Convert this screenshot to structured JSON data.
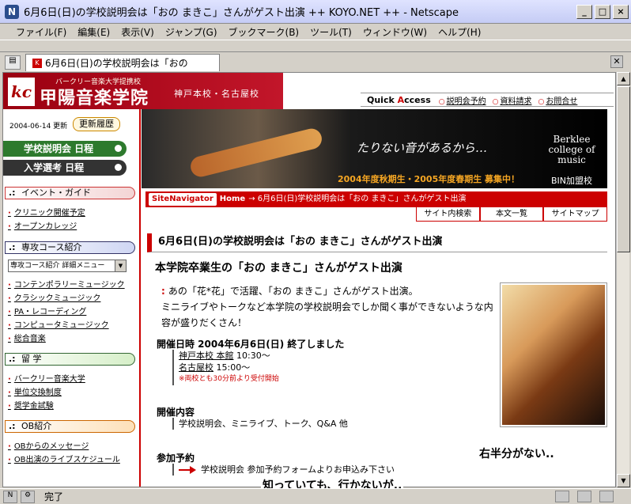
{
  "window": {
    "title": "6月6日(日)の学校説明会は「おの まきこ」さんがゲスト出演 ++ KOYO.NET ++ - Netscape",
    "app_icon": "netscape-icon"
  },
  "menu": [
    "ファイル(F)",
    "編集(E)",
    "表示(V)",
    "ジャンプ(G)",
    "ブックマーク(B)",
    "ツール(T)",
    "ウィンドウ(W)",
    "ヘルプ(H)"
  ],
  "tab": {
    "label": "6月6日(日)の学校説明会は「おの"
  },
  "site": {
    "logo_mark": "kc",
    "logo_sub": "バークリー音楽大学提携校",
    "logo_name": "甲陽音楽学院",
    "campus": "神戸本校・名古屋校",
    "quick_access_a": "Quick ",
    "quick_access_b": "A",
    "quick_access_c": "ccess",
    "quick_links": [
      "説明会予約",
      "資料請求",
      "お問合せ"
    ]
  },
  "left": {
    "date": "2004-06-14 更新",
    "update_btn": "更新履歴",
    "nav_btn1": "学校説明会 日程",
    "nav_btn2": "入学選考 日程",
    "sec_event": "イベント・ガイド",
    "event_links": [
      "クリニック開催予定",
      "オープンカレッジ"
    ],
    "sec_course": "専攻コース紹介",
    "course_select": "専攻コース紹介 詳細メニュー",
    "course_links": [
      "コンテンポラリーミュージック",
      "クラシックミュージック",
      "PA・レコーディング",
      "コンピュータミュージック",
      "総合音楽"
    ],
    "sec_study": "留 学",
    "study_links": [
      "バークリー音楽大学",
      "単位交換制度",
      "奨学金試験"
    ],
    "sec_ob": "OB紹介",
    "ob_links": [
      "OBからのメッセージ",
      "OB出演のライブスケジュール"
    ]
  },
  "banner": {
    "tagline": "たりない音があるから…",
    "berklee": "Berklee college of music",
    "recruit": "2004年度秋期生・2005年度春期生 募集中！",
    "bin": "BIN加盟校"
  },
  "sitenav": {
    "label": "SiteNavigator",
    "home": "Home",
    "crumb": "→ 6月6日(日)学校説明会は「おの まきこ」さんがゲスト出演"
  },
  "tools": [
    "サイト内検索",
    "本文一覧",
    "サイトマップ"
  ],
  "article": {
    "h1": "6月6日(日)の学校説明会は「おの まきこ」さんがゲスト出演",
    "h2": "本学院卒業生の「おの まきこ」さんがゲスト出演",
    "intro1": "あの「花*花」で活躍、「おの まきこ」さんがゲスト出演。",
    "intro2": "ミニライブやトークなど本学院の学校説明会でしか聞く事ができないような内容が盛りだくさん！",
    "date_head": "開催日時 2004年6月6日(日) 終了しました",
    "venue1": "神戸本校 本館",
    "time1": " 10:30～",
    "venue2": "名古屋校",
    "time2": " 15:00～",
    "note": "※両校とも30分前より受付開始",
    "content_head": "開催内容",
    "content": "学校説明会、ミニライブ、トーク、Q&A 他",
    "reserve_head": "参加予約",
    "reserve": "学校説明会 参加予約フォームよりお申込み下さい"
  },
  "annotations": {
    "right": "右半分がない..",
    "bottom": "知っていても、行かないが.."
  },
  "status": {
    "text": "完了"
  },
  "colors": {
    "brand_red": "#c00000",
    "nav_green": "#2d7a2d",
    "nav_dark": "#333333"
  }
}
